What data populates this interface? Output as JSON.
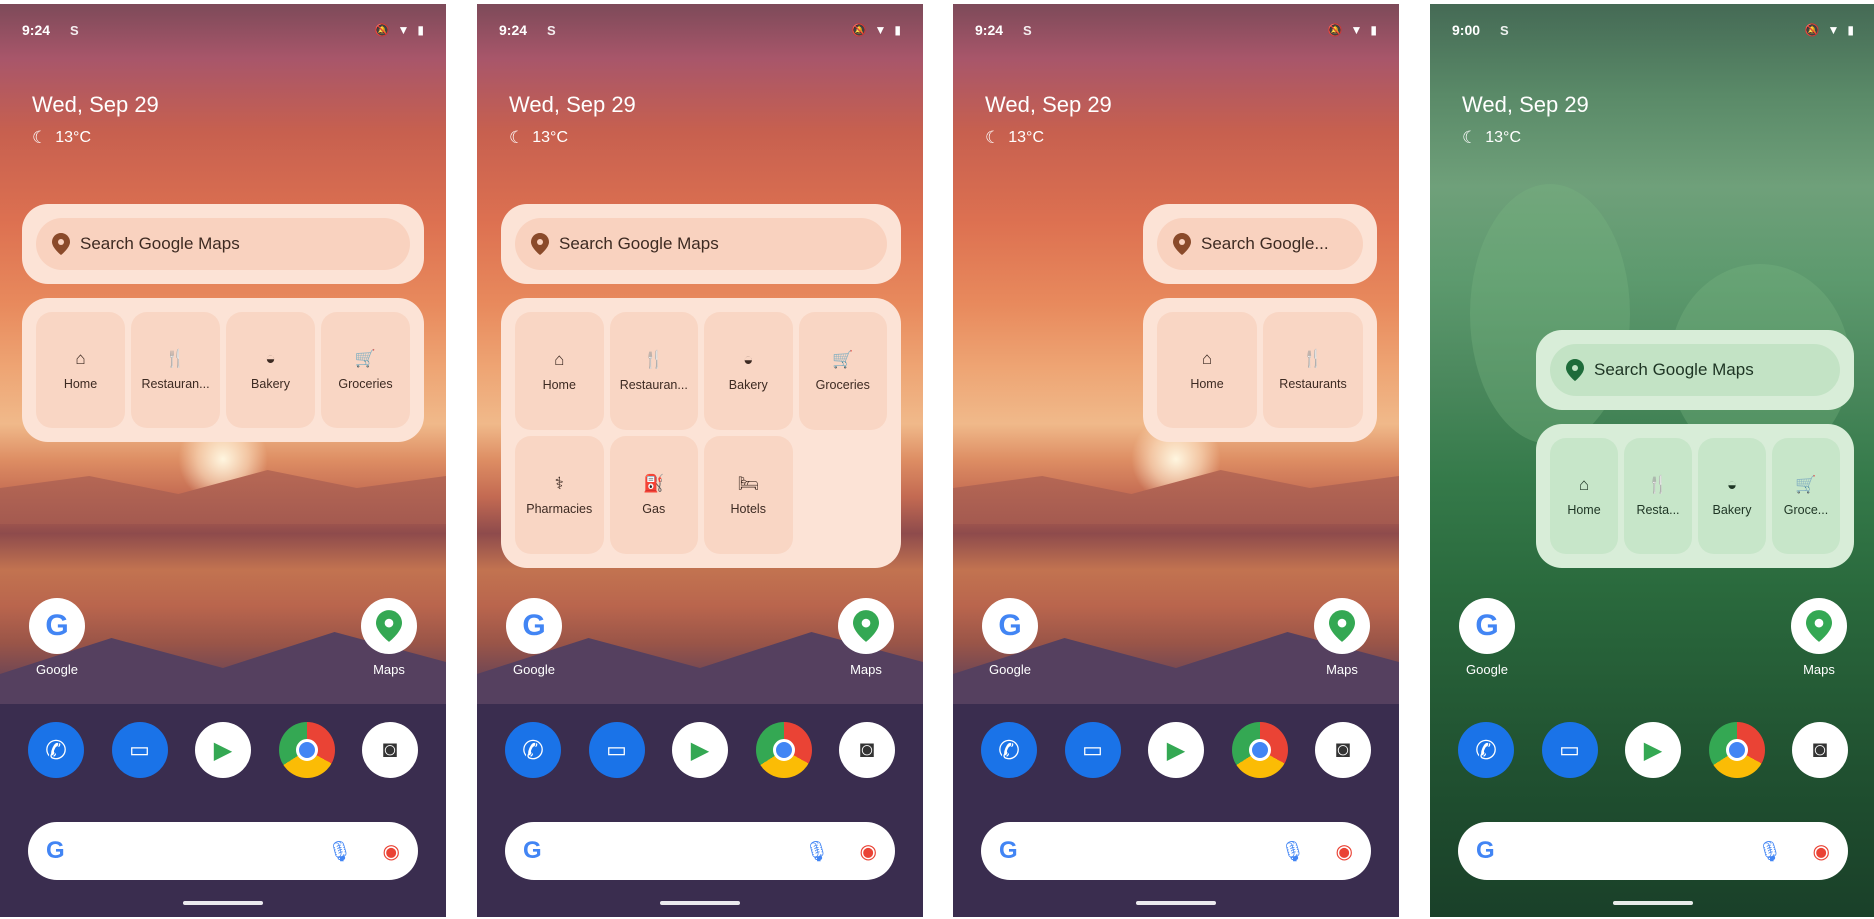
{
  "screens": [
    {
      "status": {
        "time": "9:24",
        "sim": "S"
      },
      "date": "Wed, Sep 29",
      "temp": "13°C",
      "search_label": "Search Google Maps",
      "shortcuts": [
        {
          "label": "Home",
          "icon": "home-icon"
        },
        {
          "label": "Restauran...",
          "icon": "restaurant-icon"
        },
        {
          "label": "Bakery",
          "icon": "bakery-icon"
        },
        {
          "label": "Groceries",
          "icon": "cart-icon"
        }
      ],
      "apps": {
        "google": "Google",
        "maps": "Maps"
      }
    },
    {
      "status": {
        "time": "9:24",
        "sim": "S"
      },
      "date": "Wed, Sep 29",
      "temp": "13°C",
      "search_label": "Search Google Maps",
      "shortcuts": [
        {
          "label": "Home",
          "icon": "home-icon"
        },
        {
          "label": "Restauran...",
          "icon": "restaurant-icon"
        },
        {
          "label": "Bakery",
          "icon": "bakery-icon"
        },
        {
          "label": "Groceries",
          "icon": "cart-icon"
        },
        {
          "label": "Pharmacies",
          "icon": "pharmacy-icon"
        },
        {
          "label": "Gas",
          "icon": "gas-icon"
        },
        {
          "label": "Hotels",
          "icon": "hotel-icon"
        }
      ],
      "apps": {
        "google": "Google",
        "maps": "Maps"
      }
    },
    {
      "status": {
        "time": "9:24",
        "sim": "S"
      },
      "date": "Wed, Sep 29",
      "temp": "13°C",
      "search_label": "Search Google...",
      "shortcuts": [
        {
          "label": "Home",
          "icon": "home-icon"
        },
        {
          "label": "Restaurants",
          "icon": "restaurant-icon"
        }
      ],
      "apps": {
        "google": "Google",
        "maps": "Maps"
      }
    },
    {
      "status": {
        "time": "9:00",
        "sim": "S"
      },
      "date": "Wed, Sep 29",
      "temp": "13°C",
      "search_label": "Search Google Maps",
      "shortcuts": [
        {
          "label": "Home",
          "icon": "home-icon"
        },
        {
          "label": "Resta...",
          "icon": "restaurant-icon"
        },
        {
          "label": "Bakery",
          "icon": "bakery-icon"
        },
        {
          "label": "Groce...",
          "icon": "cart-icon"
        }
      ],
      "apps": {
        "google": "Google",
        "maps": "Maps"
      }
    }
  ],
  "colors": {
    "widget_peach": "#fce3d6",
    "widget_mint": "#d8edd8",
    "accent_brown": "#8a4a2a",
    "accent_green": "#1e6b3a"
  }
}
